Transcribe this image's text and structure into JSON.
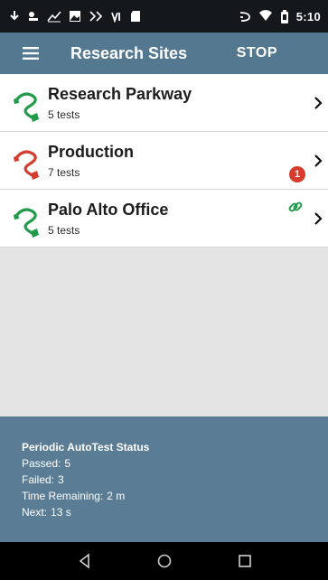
{
  "status_bar": {
    "time": "5:10",
    "left_icons": [
      "download-icon",
      "battery-saver-icon",
      "stats-icon",
      "image-icon",
      "signal-test-icon",
      "vpn-icon",
      "sd-card-icon"
    ],
    "right_icons": [
      "cast-icon",
      "wifi-icon",
      "battery-icon"
    ]
  },
  "app_bar": {
    "title": "Research Sites",
    "stop_label": "STOP"
  },
  "sites": [
    {
      "name": "Research Parkway",
      "tests": "5 tests",
      "status_color": "#1f9b4a"
    },
    {
      "name": "Production",
      "tests": "7 tests",
      "status_color": "#d63c2e",
      "alert_count": "1"
    },
    {
      "name": "Palo Alto Office",
      "tests": "5 tests",
      "status_color": "#1f9b4a",
      "linked": true
    }
  ],
  "status_panel": {
    "title": "Periodic AutoTest Status",
    "passed_label": "Passed:",
    "passed_value": "5",
    "failed_label": "Failed:",
    "failed_value": "3",
    "time_remaining_label": "Time Remaining:",
    "time_remaining_value": "2 m",
    "next_label": "Next:",
    "next_value": "13 s"
  },
  "nav_bar": {
    "buttons": [
      "back-icon",
      "home-icon",
      "recents-icon"
    ]
  },
  "colors": {
    "app_bar": "#54788f",
    "status_panel": "#5a7d95",
    "ok": "#1f9b4a",
    "fail": "#d63c2e"
  }
}
